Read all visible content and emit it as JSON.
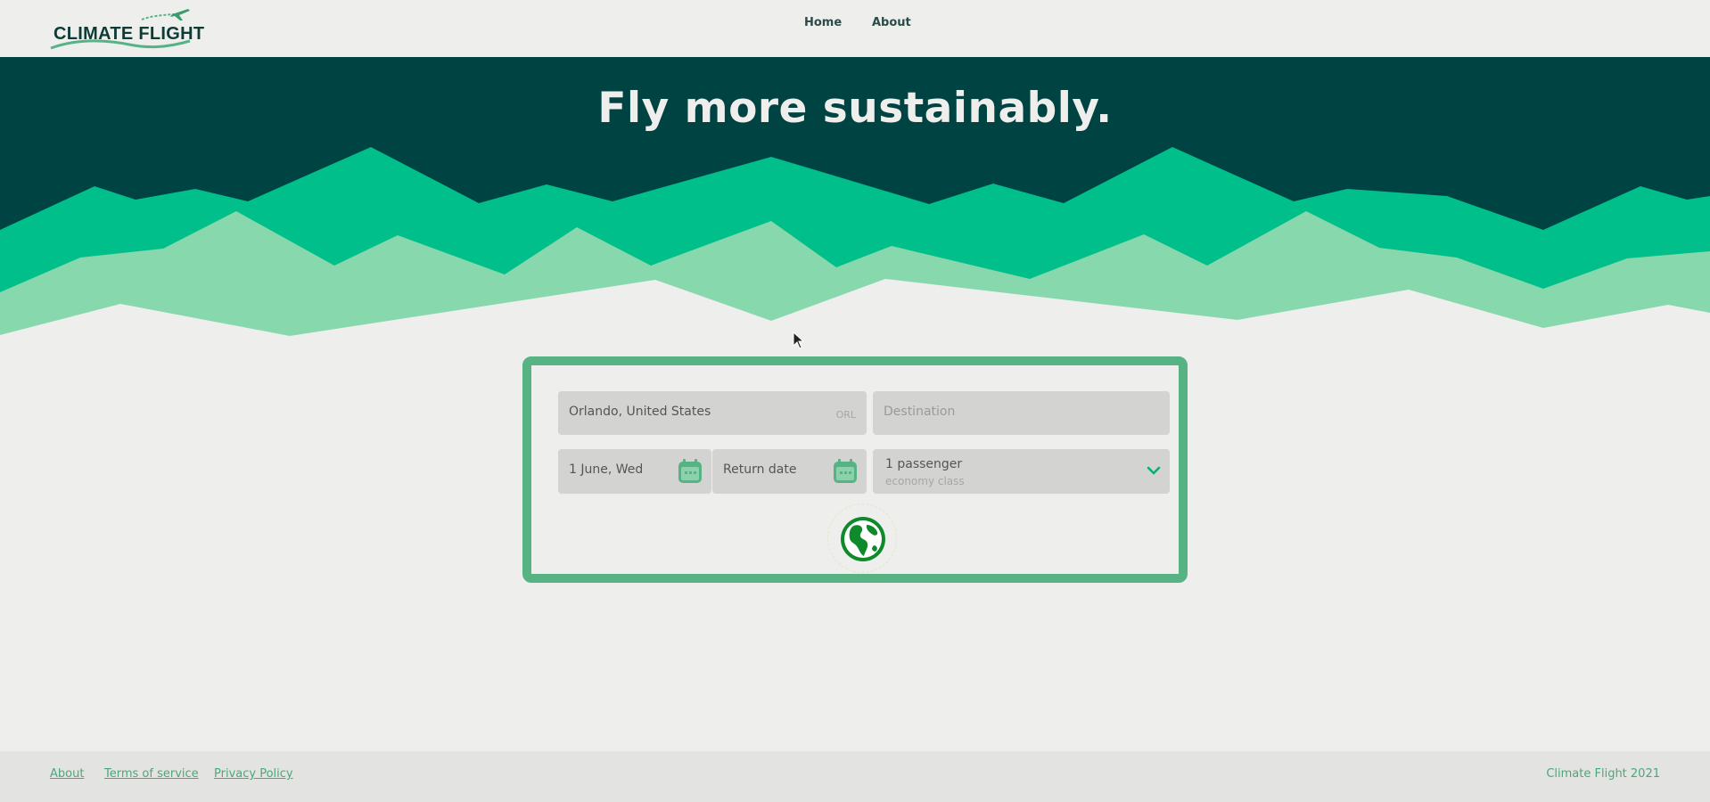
{
  "header": {
    "logo_text": "CLIMATE FLIGHT",
    "nav": [
      {
        "label": "Home"
      },
      {
        "label": "About"
      }
    ]
  },
  "hero": {
    "title": "Fly more sustainably."
  },
  "search": {
    "origin": {
      "value": "Orlando, United States",
      "code": "ORL"
    },
    "destination": {
      "placeholder": "Destination"
    },
    "depart": {
      "value": "1 June, Wed"
    },
    "return": {
      "placeholder": "Return date"
    },
    "passengers": {
      "count_label": "1 passenger",
      "class_label": "economy class"
    }
  },
  "footer": {
    "links": [
      {
        "label": "About"
      },
      {
        "label": "Terms of service"
      },
      {
        "label": "Privacy Policy"
      }
    ],
    "copyright": "Climate Flight 2021"
  },
  "colors": {
    "dark_teal": "#004343",
    "green": "#00bf8a",
    "light_green": "#88d8ae",
    "card_border": "#57b384",
    "field_bg": "#d3d3d2",
    "link": "#48a97a",
    "globe": "#0e8a2a"
  },
  "icons": [
    "plane-icon",
    "calendar-icon",
    "chevron-down-icon",
    "globe-icon"
  ]
}
